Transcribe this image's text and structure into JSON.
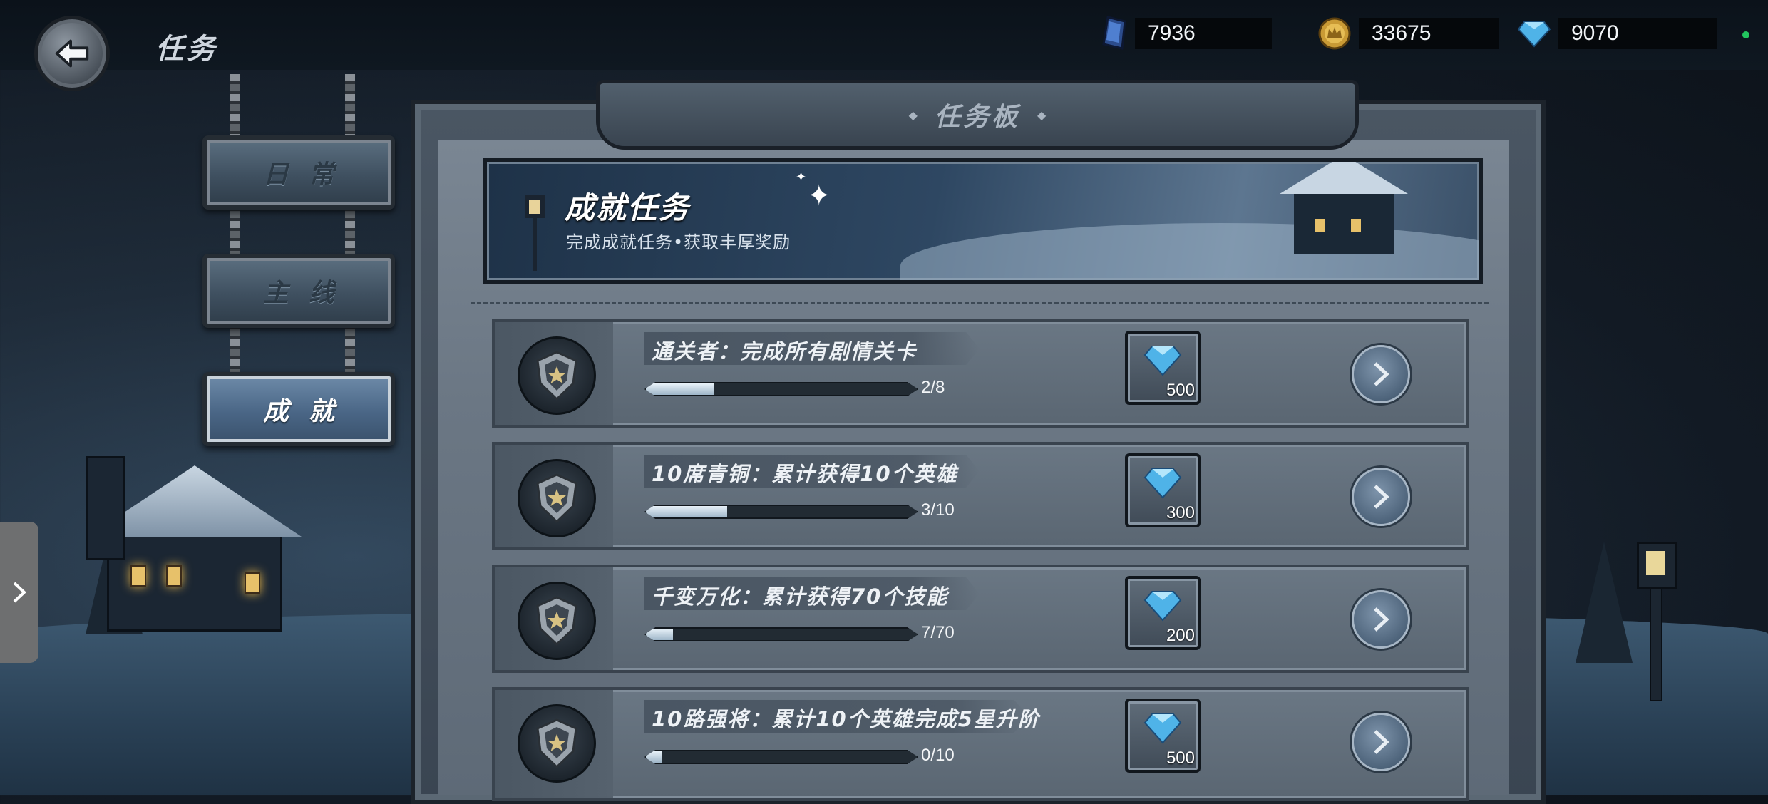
{
  "header": {
    "title": "任务"
  },
  "currencies": [
    {
      "icon": "crystal-icon",
      "value": "7936"
    },
    {
      "icon": "gold-coin-icon",
      "value": "33675"
    },
    {
      "icon": "diamond-icon",
      "value": "9070"
    }
  ],
  "tabs": [
    {
      "label": "日常",
      "active": false
    },
    {
      "label": "主线",
      "active": false
    },
    {
      "label": "成就",
      "active": true
    }
  ],
  "board": {
    "title": "任务板"
  },
  "banner": {
    "title": "成就任务",
    "subtitle": "完成成就任务•获取丰厚奖励"
  },
  "tasks": [
    {
      "title": "通关者：完成所有剧情关卡",
      "progress_text": "2/8",
      "progress": 0.25,
      "reward_icon": "diamond-icon",
      "reward": "500"
    },
    {
      "title": "10席青铜：累计获得10个英雄",
      "progress_text": "3/10",
      "progress": 0.3,
      "reward_icon": "diamond-icon",
      "reward": "300"
    },
    {
      "title": "千变万化：累计获得70个技能",
      "progress_text": "7/70",
      "progress": 0.1,
      "reward_icon": "diamond-icon",
      "reward": "200"
    },
    {
      "title": "10路强将：累计10个英雄完成5星升阶",
      "progress_text": "0/10",
      "progress": 0.0,
      "reward_icon": "diamond-icon",
      "reward": "500"
    }
  ],
  "colors": {
    "accent_active_tab": "#4a6686",
    "progress_fill": "#dfeaf3",
    "status_dot": "#22c55e"
  }
}
